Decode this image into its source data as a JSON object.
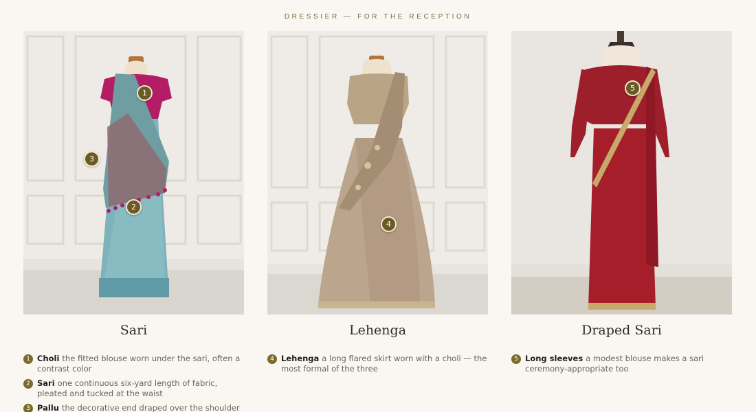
{
  "eyebrow": "DRESSIER — FOR THE RECEPTION",
  "colors": {
    "accent": "#6b5a25",
    "background": "#faf7f2"
  },
  "cards": [
    {
      "title": "Sari",
      "pins": [
        "1",
        "2",
        "3"
      ],
      "notes": [
        {
          "num": "1",
          "term": "Choli",
          "text": "the fitted blouse worn under the sari, often a contrast color"
        },
        {
          "num": "2",
          "term": "Sari",
          "text": "one continuous six-yard length of fabric, pleated and tucked at the waist"
        },
        {
          "num": "3",
          "term": "Pallu",
          "text": "the decorative end draped over the shoulder"
        }
      ]
    },
    {
      "title": "Lehenga",
      "pins": [
        "4"
      ],
      "notes": [
        {
          "num": "4",
          "term": "Lehenga",
          "text": "a long flared skirt worn with a choli — the most formal of the three"
        }
      ]
    },
    {
      "title": "Draped Sari",
      "pins": [
        "5"
      ],
      "notes": [
        {
          "num": "5",
          "term": "Long sleeves",
          "text": "a modest blouse makes a sari ceremony-appropriate too"
        }
      ]
    }
  ]
}
